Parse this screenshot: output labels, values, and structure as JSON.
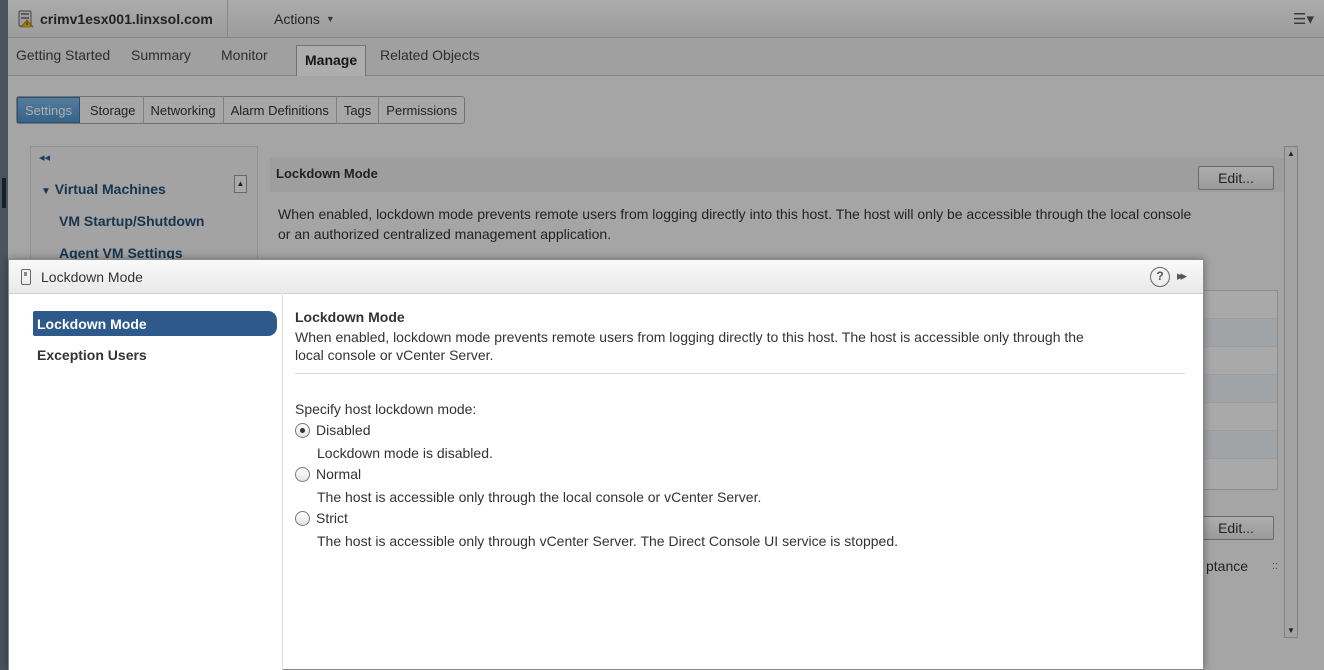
{
  "header": {
    "host_name": "crimv1esx001.linxsol.com",
    "actions_label": "Actions"
  },
  "nav_tabs": [
    "Getting Started",
    "Summary",
    "Monitor",
    "Manage",
    "Related Objects"
  ],
  "sub_tabs": [
    "Settings",
    "Storage",
    "Networking",
    "Alarm Definitions",
    "Tags",
    "Permissions"
  ],
  "settings_nav": {
    "group": "Virtual Machines",
    "items": [
      "VM Startup/Shutdown",
      "Agent VM Settings"
    ]
  },
  "background_content": {
    "section_title": "Lockdown Mode",
    "edit_label": "Edit...",
    "description_line1": "When enabled, lockdown mode prevents remote users from logging directly into this host. The host will only be accessible through the local console",
    "description_line2": "or an authorized centralized management application.",
    "partial_text": "ptance",
    "grip": "::"
  },
  "dialog": {
    "title": "Lockdown Mode",
    "help": "?",
    "nav": [
      "Lockdown Mode",
      "Exception Users"
    ],
    "section_title": "Lockdown Mode",
    "section_desc_line1": "When enabled, lockdown mode prevents remote users from logging directly to this host. The host is accessible only through the",
    "section_desc_line2": "local console or vCenter Server.",
    "prompt": "Specify host lockdown mode:",
    "options": [
      {
        "label": "Disabled",
        "description": "Lockdown mode is disabled.",
        "selected": true
      },
      {
        "label": "Normal",
        "description": "The host is accessible only through the local console or vCenter Server.",
        "selected": false
      },
      {
        "label": "Strict",
        "description": "The host is accessible only through vCenter Server. The Direct Console UI service is stopped.",
        "selected": false
      }
    ]
  },
  "colors": {
    "selection_blue": "#2d5a8a",
    "active_subtab": "#4e93cc",
    "nav_text": "#244e73"
  }
}
